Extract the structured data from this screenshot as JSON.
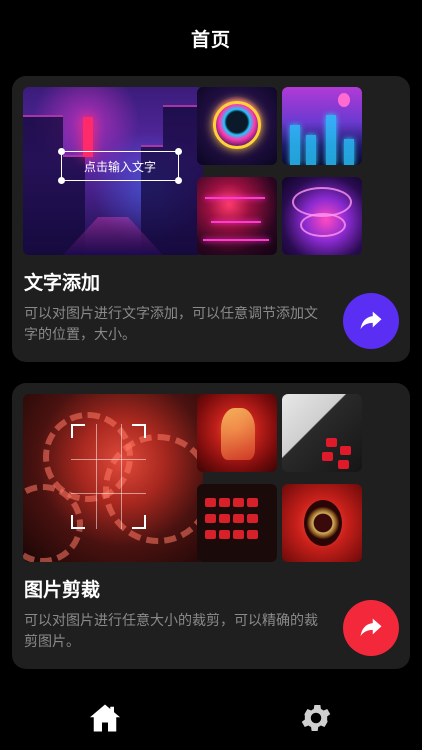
{
  "header": {
    "title": "首页"
  },
  "cards": [
    {
      "title": "文字添加",
      "description": "可以对图片进行文字添加，可以任意调节添加文字的位置，大小。",
      "preview_text": "点击输入文字",
      "accent": "#5b2ef3",
      "action_icon": "share-arrow-icon"
    },
    {
      "title": "图片剪裁",
      "description": "可以对图片进行任意大小的裁剪，可以精确的裁剪图片。",
      "accent": "#f3283a",
      "action_icon": "share-arrow-icon"
    }
  ],
  "tabbar": {
    "items": [
      {
        "icon": "home-icon",
        "active": true
      },
      {
        "icon": "gear-icon",
        "active": false
      }
    ]
  },
  "colors": {
    "background": "#000000",
    "card": "#1f1f1f",
    "description": "#8a8a8a"
  }
}
